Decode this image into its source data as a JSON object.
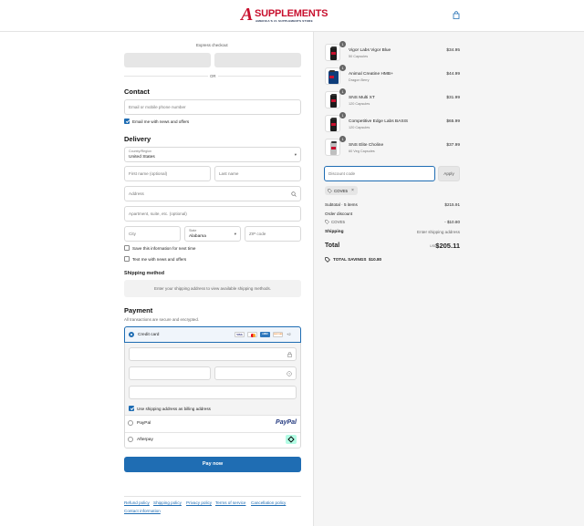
{
  "brand": {
    "logo_a": "A",
    "logo_word": "SUPPLEMENTS",
    "tagline": "AMERICA'S #1 SUPPLEMENTS STORE"
  },
  "express": {
    "label": "Express checkout",
    "or": "OR"
  },
  "contact": {
    "heading": "Contact",
    "email_placeholder": "Email or mobile phone number",
    "news_label": "Email me with news and offers"
  },
  "delivery": {
    "heading": "Delivery",
    "country_label": "Country/Region",
    "country_value": "United States",
    "first_name": "First name (optional)",
    "last_name": "Last name",
    "address": "Address",
    "apartment": "Apartment, suite, etc. (optional)",
    "city": "City",
    "state_label": "State",
    "state_value": "Alabama",
    "zip": "ZIP code",
    "save_info": "Save this information for next time",
    "text_me": "Text me with news and offers"
  },
  "shipping": {
    "heading": "Shipping method",
    "notice": "Enter your shipping address to view available shipping methods."
  },
  "payment": {
    "heading": "Payment",
    "subheading": "All transactions are secure and encrypted.",
    "credit_card": "Credit card",
    "card_brands": [
      "VISA",
      "MC",
      "AMEX",
      "DISCOVER"
    ],
    "more_cards": "+2",
    "billing_same": "Use shipping address as billing address",
    "paypal": "PayPal",
    "paypal_logo": "PayPal",
    "afterpay": "Afterpay"
  },
  "pay_button": "Pay now",
  "footer": {
    "links": [
      "Refund policy",
      "Shipping policy",
      "Privacy policy",
      "Terms of service",
      "Cancellation policy",
      "Contact information"
    ]
  },
  "cart": {
    "items": [
      {
        "name": "Vigor Labs Vigor Blue",
        "variant": "50 Capsules",
        "price": "$34.95",
        "qty": "1"
      },
      {
        "name": "Animal Creatine HMB+",
        "variant": "Dragon Berry",
        "price": "$44.99",
        "qty": "1"
      },
      {
        "name": "SNS Multi XT",
        "variant": "120 Capsules",
        "price": "$31.99",
        "qty": "1"
      },
      {
        "name": "Competitive Edge Labs BASIS",
        "variant": "120 Capsules",
        "price": "$65.99",
        "qty": "1"
      },
      {
        "name": "SNS Elite Choline",
        "variant": "60 Veg Capsules",
        "price": "$37.99",
        "qty": "1"
      }
    ],
    "discount_placeholder": "Discount code",
    "apply": "Apply",
    "code_tag": "COVE5",
    "subtotal_label": "Subtotal · 5 items",
    "subtotal_value": "$215.91",
    "order_discount_label": "Order discount",
    "discount_code": "COVE5",
    "discount_value": "- $10.80",
    "shipping_label": "Shipping",
    "shipping_value": "Enter shipping address",
    "total_label": "Total",
    "currency": "USD",
    "total_value": "$205.11",
    "savings_label": "TOTAL SAVINGS",
    "savings_value": "$10.80"
  },
  "colors": {
    "accent": "#1f6db3",
    "brand_red": "#c8102e",
    "right_bg": "#f5f5f5"
  }
}
